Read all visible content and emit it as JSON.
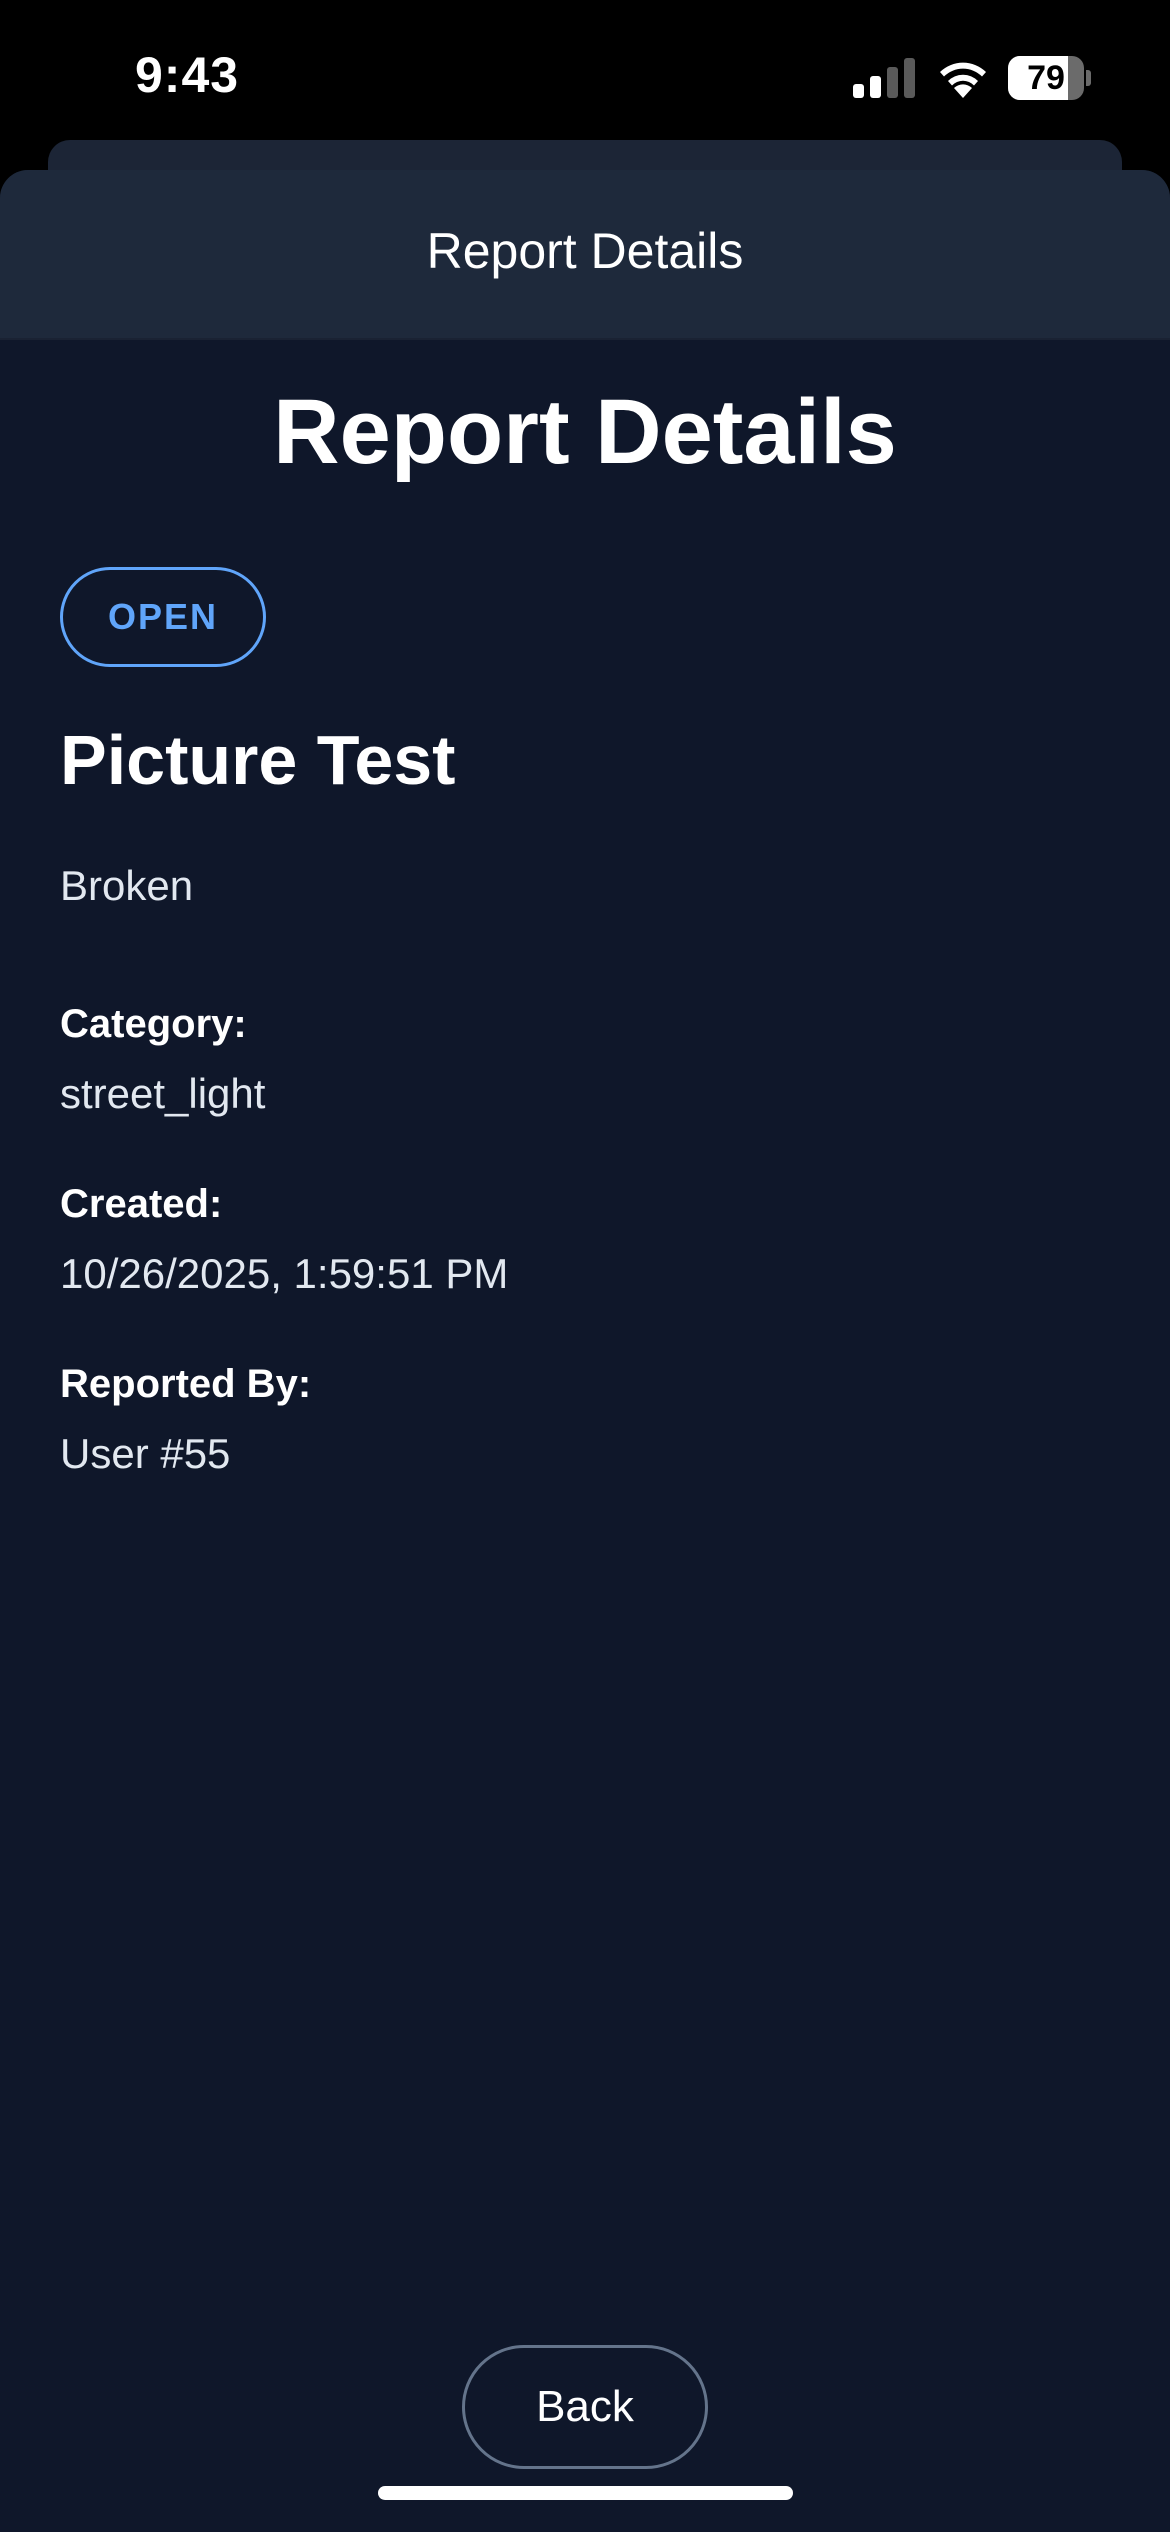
{
  "status_bar": {
    "time": "9:43",
    "battery_level": 79,
    "battery_label": "79",
    "signal_bars_active": 2,
    "signal_bars_total": 4,
    "icons": [
      "signal-icon",
      "wifi-icon",
      "battery-icon"
    ]
  },
  "header": {
    "title": "Report Details"
  },
  "main": {
    "title": "Report Details",
    "status_badge": "OPEN",
    "report_title": "Picture Test",
    "description": "Broken",
    "fields": {
      "category": {
        "label": "Category:",
        "value": "street_light"
      },
      "created": {
        "label": "Created:",
        "value": "10/26/2025, 1:59:51 PM"
      },
      "reported_by": {
        "label": "Reported By:",
        "value": "User #55"
      }
    }
  },
  "footer": {
    "back_label": "Back"
  },
  "colors": {
    "background": "#0f172a",
    "header_bg": "#1e293b",
    "badge_accent": "#60a5fa",
    "text_primary": "#ffffff",
    "text_secondary": "#e2e8f0",
    "button_border": "#64748b"
  }
}
